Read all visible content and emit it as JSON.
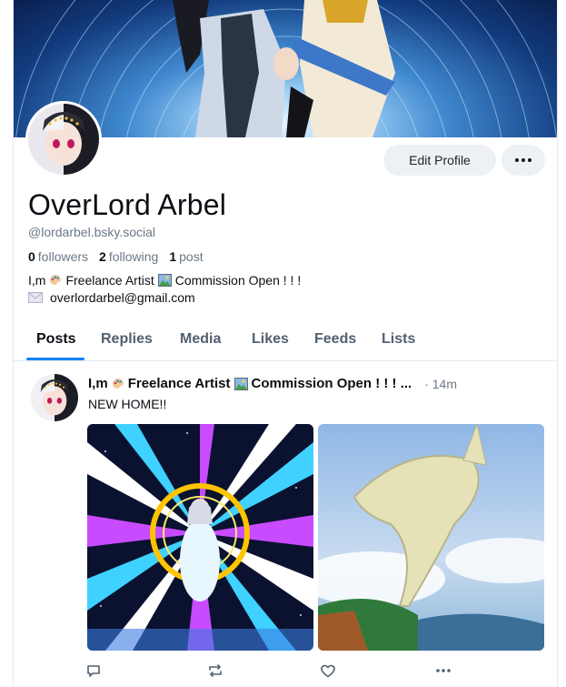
{
  "profile": {
    "display_name": "OverLord Arbel",
    "handle": "@lordarbel.bsky.social",
    "edit_label": "Edit Profile",
    "followers_count": "0",
    "followers_label": "followers",
    "following_count": "2",
    "following_label": "following",
    "posts_count": "1",
    "posts_label": "post",
    "bio_line1_a": "I,m",
    "bio_line1_b": "Freelance Artist",
    "bio_line1_c": "Commission Open ! ! !",
    "bio_line2": "overlordarbel@gmail.com"
  },
  "tabs": [
    {
      "label": "Posts",
      "active": true
    },
    {
      "label": "Replies"
    },
    {
      "label": "Media"
    },
    {
      "label": "Likes"
    },
    {
      "label": "Feeds"
    },
    {
      "label": "Lists"
    }
  ],
  "post": {
    "author_a": "I,m",
    "author_b": "Freelance Artist",
    "author_c": "Commission Open ! ! ! ...",
    "time": "· 14m",
    "text": "NEW HOME!!"
  },
  "icons": {
    "more": "ellipsis-icon",
    "reply": "reply-icon",
    "repost": "repost-icon",
    "like": "heart-icon",
    "post_more": "ellipsis-icon"
  },
  "colors": {
    "accent": "#1083fe",
    "muted_text": "#6b7886",
    "button_bg": "#eef1f4"
  }
}
